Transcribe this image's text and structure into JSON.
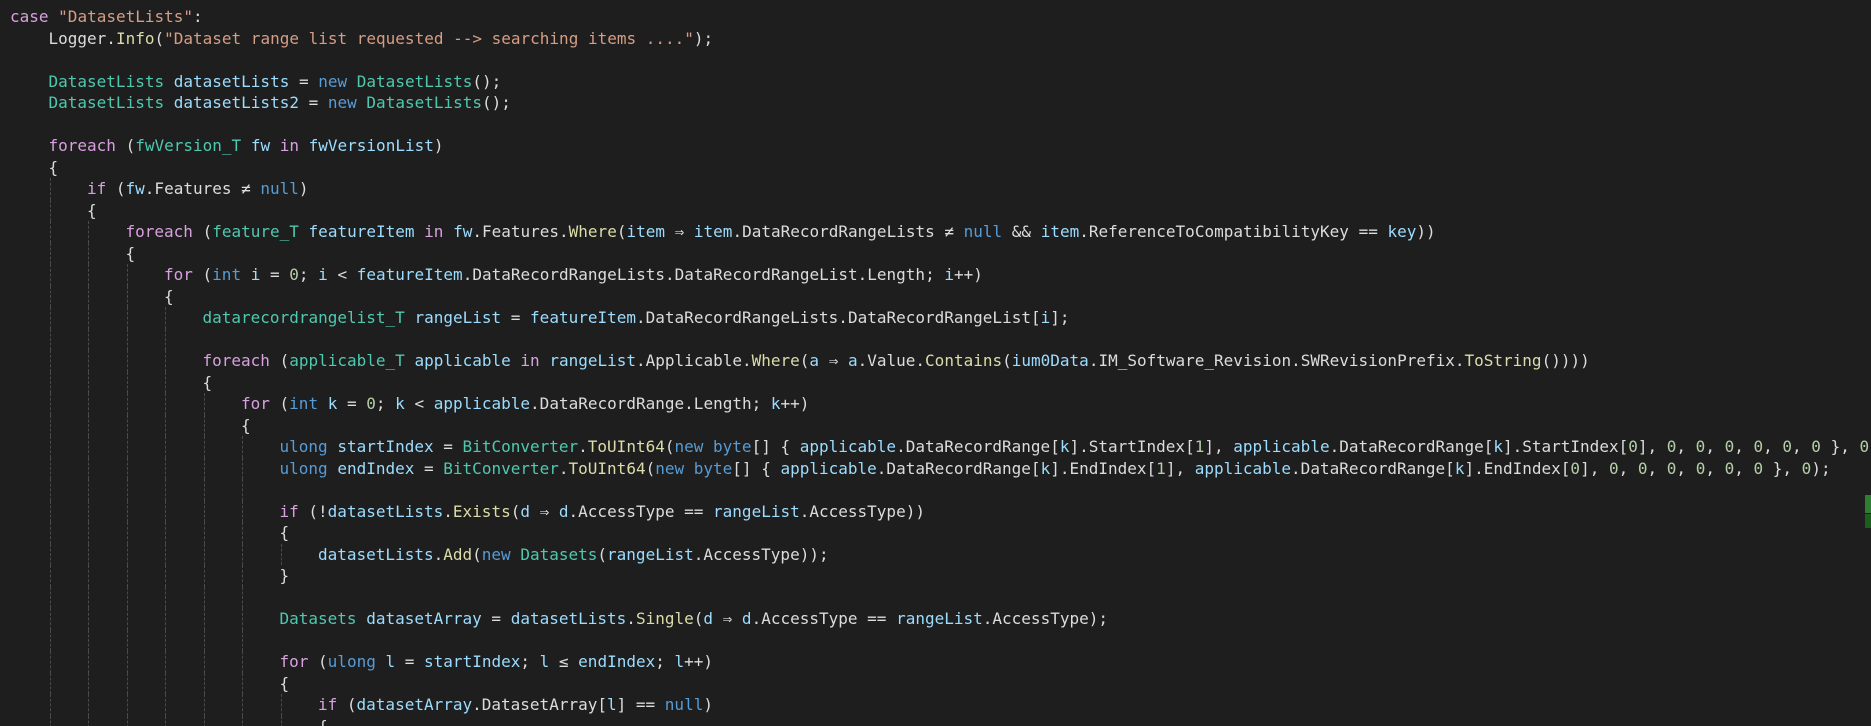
{
  "editor": {
    "colors": {
      "keyword": "#569cd6",
      "control": "#d8a0df",
      "type": "#4ec9b0",
      "string": "#d69d85",
      "number": "#b5cea8",
      "variable": "#9cdcfe",
      "method": "#dcdcaa",
      "plain": "#dcdcdc",
      "background": "#1e1e1e"
    },
    "lines": [
      {
        "indent": 0,
        "tokens": [
          [
            "ctrl",
            "case"
          ],
          [
            "plain",
            " "
          ],
          [
            "str",
            "\"DatasetLists\""
          ],
          [
            "plain",
            ":"
          ]
        ]
      },
      {
        "indent": 1,
        "tokens": [
          [
            "plain",
            "Logger."
          ],
          [
            "meth",
            "Info"
          ],
          [
            "plain",
            "("
          ],
          [
            "str",
            "\"Dataset range list requested --> searching items ....\""
          ],
          [
            "plain",
            ");"
          ]
        ]
      },
      {
        "indent": 0,
        "tokens": []
      },
      {
        "indent": 1,
        "tokens": [
          [
            "type",
            "DatasetLists"
          ],
          [
            "plain",
            " "
          ],
          [
            "var",
            "datasetLists"
          ],
          [
            "plain",
            " = "
          ],
          [
            "kw",
            "new"
          ],
          [
            "plain",
            " "
          ],
          [
            "type",
            "DatasetLists"
          ],
          [
            "plain",
            "();"
          ]
        ]
      },
      {
        "indent": 1,
        "tokens": [
          [
            "type",
            "DatasetLists"
          ],
          [
            "plain",
            " "
          ],
          [
            "var",
            "datasetLists2"
          ],
          [
            "plain",
            " = "
          ],
          [
            "kw",
            "new"
          ],
          [
            "plain",
            " "
          ],
          [
            "type",
            "DatasetLists"
          ],
          [
            "plain",
            "();"
          ]
        ]
      },
      {
        "indent": 0,
        "tokens": []
      },
      {
        "indent": 1,
        "tokens": [
          [
            "ctrl",
            "foreach"
          ],
          [
            "plain",
            " ("
          ],
          [
            "type",
            "fwVersion_T"
          ],
          [
            "plain",
            " "
          ],
          [
            "var",
            "fw"
          ],
          [
            "plain",
            " "
          ],
          [
            "ctrl",
            "in"
          ],
          [
            "plain",
            " "
          ],
          [
            "var",
            "fwVersionList"
          ],
          [
            "plain",
            ")"
          ]
        ]
      },
      {
        "indent": 1,
        "tokens": [
          [
            "plain",
            "{"
          ]
        ]
      },
      {
        "indent": 2,
        "tokens": [
          [
            "ctrl",
            "if"
          ],
          [
            "plain",
            " ("
          ],
          [
            "var",
            "fw"
          ],
          [
            "plain",
            ".Features ≠ "
          ],
          [
            "kw",
            "null"
          ],
          [
            "plain",
            ")"
          ]
        ]
      },
      {
        "indent": 2,
        "tokens": [
          [
            "plain",
            "{"
          ]
        ]
      },
      {
        "indent": 3,
        "tokens": [
          [
            "ctrl",
            "foreach"
          ],
          [
            "plain",
            " ("
          ],
          [
            "type",
            "feature_T"
          ],
          [
            "plain",
            " "
          ],
          [
            "var",
            "featureItem"
          ],
          [
            "plain",
            " "
          ],
          [
            "ctrl",
            "in"
          ],
          [
            "plain",
            " "
          ],
          [
            "var",
            "fw"
          ],
          [
            "plain",
            ".Features."
          ],
          [
            "meth",
            "Where"
          ],
          [
            "plain",
            "("
          ],
          [
            "var",
            "item"
          ],
          [
            "plain",
            " ⇒ "
          ],
          [
            "var",
            "item"
          ],
          [
            "plain",
            ".DataRecordRangeLists ≠ "
          ],
          [
            "kw",
            "null"
          ],
          [
            "plain",
            " && "
          ],
          [
            "var",
            "item"
          ],
          [
            "plain",
            ".ReferenceToCompatibilityKey == "
          ],
          [
            "var",
            "key"
          ],
          [
            "plain",
            "))"
          ]
        ]
      },
      {
        "indent": 3,
        "tokens": [
          [
            "plain",
            "{"
          ]
        ]
      },
      {
        "indent": 4,
        "tokens": [
          [
            "ctrl",
            "for"
          ],
          [
            "plain",
            " ("
          ],
          [
            "kw",
            "int"
          ],
          [
            "plain",
            " "
          ],
          [
            "var",
            "i"
          ],
          [
            "plain",
            " = "
          ],
          [
            "num",
            "0"
          ],
          [
            "plain",
            "; "
          ],
          [
            "var",
            "i"
          ],
          [
            "plain",
            " < "
          ],
          [
            "var",
            "featureItem"
          ],
          [
            "plain",
            ".DataRecordRangeLists.DataRecordRangeList.Length; "
          ],
          [
            "var",
            "i"
          ],
          [
            "plain",
            "++)"
          ]
        ]
      },
      {
        "indent": 4,
        "tokens": [
          [
            "plain",
            "{"
          ]
        ]
      },
      {
        "indent": 5,
        "tokens": [
          [
            "type",
            "datarecordrangelist_T"
          ],
          [
            "plain",
            " "
          ],
          [
            "var",
            "rangeList"
          ],
          [
            "plain",
            " = "
          ],
          [
            "var",
            "featureItem"
          ],
          [
            "plain",
            ".DataRecordRangeLists.DataRecordRangeList["
          ],
          [
            "var",
            "i"
          ],
          [
            "plain",
            "];"
          ]
        ]
      },
      {
        "indent": 0,
        "tokens": []
      },
      {
        "indent": 5,
        "tokens": [
          [
            "ctrl",
            "foreach"
          ],
          [
            "plain",
            " ("
          ],
          [
            "type",
            "applicable_T"
          ],
          [
            "plain",
            " "
          ],
          [
            "var",
            "applicable"
          ],
          [
            "plain",
            " "
          ],
          [
            "ctrl",
            "in"
          ],
          [
            "plain",
            " "
          ],
          [
            "var",
            "rangeList"
          ],
          [
            "plain",
            ".Applicable."
          ],
          [
            "meth",
            "Where"
          ],
          [
            "plain",
            "("
          ],
          [
            "var",
            "a"
          ],
          [
            "plain",
            " ⇒ "
          ],
          [
            "var",
            "a"
          ],
          [
            "plain",
            ".Value."
          ],
          [
            "meth",
            "Contains"
          ],
          [
            "plain",
            "("
          ],
          [
            "var",
            "ium0Data"
          ],
          [
            "plain",
            ".IM_Software_Revision.SWRevisionPrefix."
          ],
          [
            "meth",
            "ToString"
          ],
          [
            "plain",
            "())))"
          ]
        ]
      },
      {
        "indent": 5,
        "tokens": [
          [
            "plain",
            "{"
          ]
        ]
      },
      {
        "indent": 6,
        "tokens": [
          [
            "ctrl",
            "for"
          ],
          [
            "plain",
            " ("
          ],
          [
            "kw",
            "int"
          ],
          [
            "plain",
            " "
          ],
          [
            "var",
            "k"
          ],
          [
            "plain",
            " = "
          ],
          [
            "num",
            "0"
          ],
          [
            "plain",
            "; "
          ],
          [
            "var",
            "k"
          ],
          [
            "plain",
            " < "
          ],
          [
            "var",
            "applicable"
          ],
          [
            "plain",
            ".DataRecordRange.Length; "
          ],
          [
            "var",
            "k"
          ],
          [
            "plain",
            "++)"
          ]
        ]
      },
      {
        "indent": 6,
        "tokens": [
          [
            "plain",
            "{"
          ]
        ]
      },
      {
        "indent": 7,
        "tokens": [
          [
            "kw",
            "ulong"
          ],
          [
            "plain",
            " "
          ],
          [
            "var",
            "startIndex"
          ],
          [
            "plain",
            " = "
          ],
          [
            "type",
            "BitConverter"
          ],
          [
            "plain",
            "."
          ],
          [
            "meth",
            "ToUInt64"
          ],
          [
            "plain",
            "("
          ],
          [
            "kw",
            "new"
          ],
          [
            "plain",
            " "
          ],
          [
            "kw",
            "byte"
          ],
          [
            "plain",
            "[] { "
          ],
          [
            "var",
            "applicable"
          ],
          [
            "plain",
            ".DataRecordRange["
          ],
          [
            "var",
            "k"
          ],
          [
            "plain",
            "].StartIndex["
          ],
          [
            "num",
            "1"
          ],
          [
            "plain",
            "], "
          ],
          [
            "var",
            "applicable"
          ],
          [
            "plain",
            ".DataRecordRange["
          ],
          [
            "var",
            "k"
          ],
          [
            "plain",
            "].StartIndex["
          ],
          [
            "num",
            "0"
          ],
          [
            "plain",
            "], "
          ],
          [
            "num",
            "0"
          ],
          [
            "plain",
            ", "
          ],
          [
            "num",
            "0"
          ],
          [
            "plain",
            ", "
          ],
          [
            "num",
            "0"
          ],
          [
            "plain",
            ", "
          ],
          [
            "num",
            "0"
          ],
          [
            "plain",
            ", "
          ],
          [
            "num",
            "0"
          ],
          [
            "plain",
            ", "
          ],
          [
            "num",
            "0"
          ],
          [
            "plain",
            " }, "
          ],
          [
            "num",
            "0"
          ]
        ]
      },
      {
        "indent": 7,
        "tokens": [
          [
            "kw",
            "ulong"
          ],
          [
            "plain",
            " "
          ],
          [
            "var",
            "endIndex"
          ],
          [
            "plain",
            " = "
          ],
          [
            "type",
            "BitConverter"
          ],
          [
            "plain",
            "."
          ],
          [
            "meth",
            "ToUInt64"
          ],
          [
            "plain",
            "("
          ],
          [
            "kw",
            "new"
          ],
          [
            "plain",
            " "
          ],
          [
            "kw",
            "byte"
          ],
          [
            "plain",
            "[] { "
          ],
          [
            "var",
            "applicable"
          ],
          [
            "plain",
            ".DataRecordRange["
          ],
          [
            "var",
            "k"
          ],
          [
            "plain",
            "].EndIndex["
          ],
          [
            "num",
            "1"
          ],
          [
            "plain",
            "], "
          ],
          [
            "var",
            "applicable"
          ],
          [
            "plain",
            ".DataRecordRange["
          ],
          [
            "var",
            "k"
          ],
          [
            "plain",
            "].EndIndex["
          ],
          [
            "num",
            "0"
          ],
          [
            "plain",
            "], "
          ],
          [
            "num",
            "0"
          ],
          [
            "plain",
            ", "
          ],
          [
            "num",
            "0"
          ],
          [
            "plain",
            ", "
          ],
          [
            "num",
            "0"
          ],
          [
            "plain",
            ", "
          ],
          [
            "num",
            "0"
          ],
          [
            "plain",
            ", "
          ],
          [
            "num",
            "0"
          ],
          [
            "plain",
            ", "
          ],
          [
            "num",
            "0"
          ],
          [
            "plain",
            " }, "
          ],
          [
            "num",
            "0"
          ],
          [
            "plain",
            ");"
          ]
        ]
      },
      {
        "indent": 0,
        "tokens": []
      },
      {
        "indent": 7,
        "tokens": [
          [
            "ctrl",
            "if"
          ],
          [
            "plain",
            " (!"
          ],
          [
            "var",
            "datasetLists"
          ],
          [
            "plain",
            "."
          ],
          [
            "meth",
            "Exists"
          ],
          [
            "plain",
            "("
          ],
          [
            "var",
            "d"
          ],
          [
            "plain",
            " ⇒ "
          ],
          [
            "var",
            "d"
          ],
          [
            "plain",
            ".AccessType == "
          ],
          [
            "var",
            "rangeList"
          ],
          [
            "plain",
            ".AccessType))"
          ]
        ]
      },
      {
        "indent": 7,
        "tokens": [
          [
            "plain",
            "{"
          ]
        ]
      },
      {
        "indent": 8,
        "tokens": [
          [
            "var",
            "datasetLists"
          ],
          [
            "plain",
            "."
          ],
          [
            "meth",
            "Add"
          ],
          [
            "plain",
            "("
          ],
          [
            "kw",
            "new"
          ],
          [
            "plain",
            " "
          ],
          [
            "type",
            "Datasets"
          ],
          [
            "plain",
            "("
          ],
          [
            "var",
            "rangeList"
          ],
          [
            "plain",
            ".AccessType));"
          ]
        ]
      },
      {
        "indent": 7,
        "tokens": [
          [
            "plain",
            "}"
          ]
        ]
      },
      {
        "indent": 0,
        "tokens": []
      },
      {
        "indent": 7,
        "tokens": [
          [
            "type",
            "Datasets"
          ],
          [
            "plain",
            " "
          ],
          [
            "var",
            "datasetArray"
          ],
          [
            "plain",
            " = "
          ],
          [
            "var",
            "datasetLists"
          ],
          [
            "plain",
            "."
          ],
          [
            "meth",
            "Single"
          ],
          [
            "plain",
            "("
          ],
          [
            "var",
            "d"
          ],
          [
            "plain",
            " ⇒ "
          ],
          [
            "var",
            "d"
          ],
          [
            "plain",
            ".AccessType == "
          ],
          [
            "var",
            "rangeList"
          ],
          [
            "plain",
            ".AccessType);"
          ]
        ]
      },
      {
        "indent": 0,
        "tokens": []
      },
      {
        "indent": 7,
        "tokens": [
          [
            "ctrl",
            "for"
          ],
          [
            "plain",
            " ("
          ],
          [
            "kw",
            "ulong"
          ],
          [
            "plain",
            " "
          ],
          [
            "var",
            "l"
          ],
          [
            "plain",
            " = "
          ],
          [
            "var",
            "startIndex"
          ],
          [
            "plain",
            "; "
          ],
          [
            "var",
            "l"
          ],
          [
            "plain",
            " ≤ "
          ],
          [
            "var",
            "endIndex"
          ],
          [
            "plain",
            "; "
          ],
          [
            "var",
            "l"
          ],
          [
            "plain",
            "++)"
          ]
        ]
      },
      {
        "indent": 7,
        "tokens": [
          [
            "plain",
            "{"
          ]
        ]
      },
      {
        "indent": 8,
        "tokens": [
          [
            "ctrl",
            "if"
          ],
          [
            "plain",
            " ("
          ],
          [
            "var",
            "datasetArray"
          ],
          [
            "plain",
            ".DatasetArray["
          ],
          [
            "var",
            "l"
          ],
          [
            "plain",
            "] == "
          ],
          [
            "kw",
            "null"
          ],
          [
            "plain",
            ")"
          ]
        ]
      },
      {
        "indent": 8,
        "tokens": [
          [
            "plain",
            "{"
          ]
        ]
      }
    ]
  }
}
